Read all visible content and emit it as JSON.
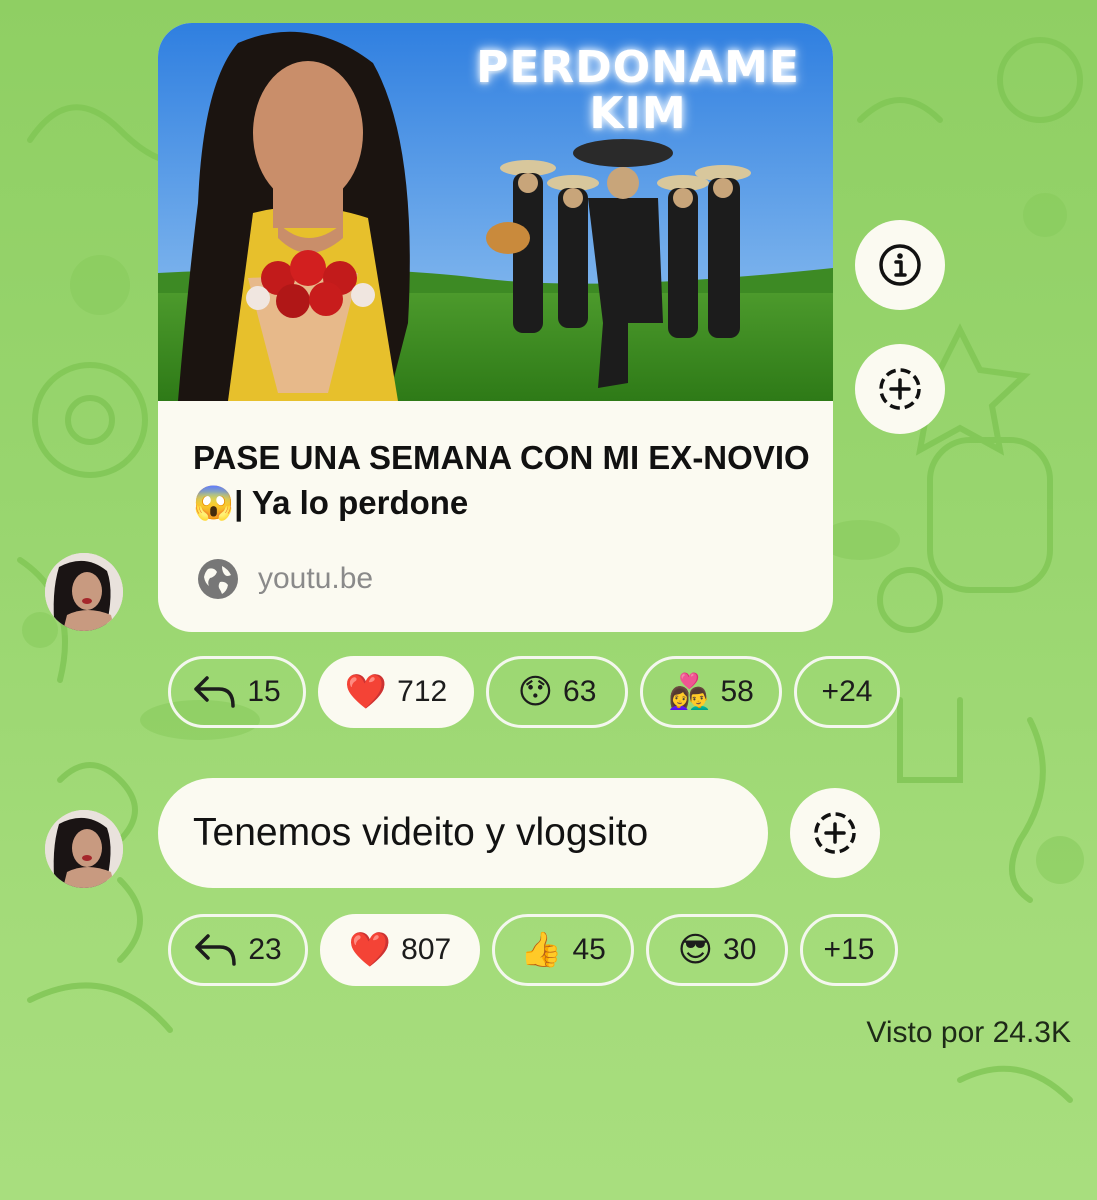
{
  "post1": {
    "thumbnail_caption": "PERDONAME\nKIM",
    "title": "PASE UNA SEMANA CON MI EX-NOVIO 😱| Ya lo perdone",
    "source": "youtu.be",
    "source_icon": "globe-icon",
    "side_buttons": [
      "info-icon",
      "add-reaction-icon"
    ],
    "reactions": [
      {
        "icon": "reply-icon",
        "count": "15",
        "active": false
      },
      {
        "emoji": "❤️",
        "count": "712",
        "active": true
      },
      {
        "emoji": "😯",
        "count": "63",
        "active": false
      },
      {
        "emoji": "👩‍❤️‍👨",
        "count": "58",
        "active": false
      },
      {
        "label": "+24",
        "active": false
      }
    ]
  },
  "post2": {
    "text": "Tenemos videito y vlogsito",
    "side_buttons": [
      "add-reaction-icon"
    ],
    "reactions": [
      {
        "icon": "reply-icon",
        "count": "23",
        "active": false
      },
      {
        "emoji": "❤️",
        "count": "807",
        "active": true
      },
      {
        "emoji": "👍",
        "count": "45",
        "active": false
      },
      {
        "emoji": "😎",
        "count": "30",
        "active": false
      },
      {
        "label": "+15",
        "active": false
      }
    ]
  },
  "views": "Visto por 24.3K",
  "colors": {
    "background": "#a6dc7d",
    "bubble": "#fbfaf1",
    "pill_border": "#f4f7ee",
    "source_text": "#8a8a8a"
  }
}
